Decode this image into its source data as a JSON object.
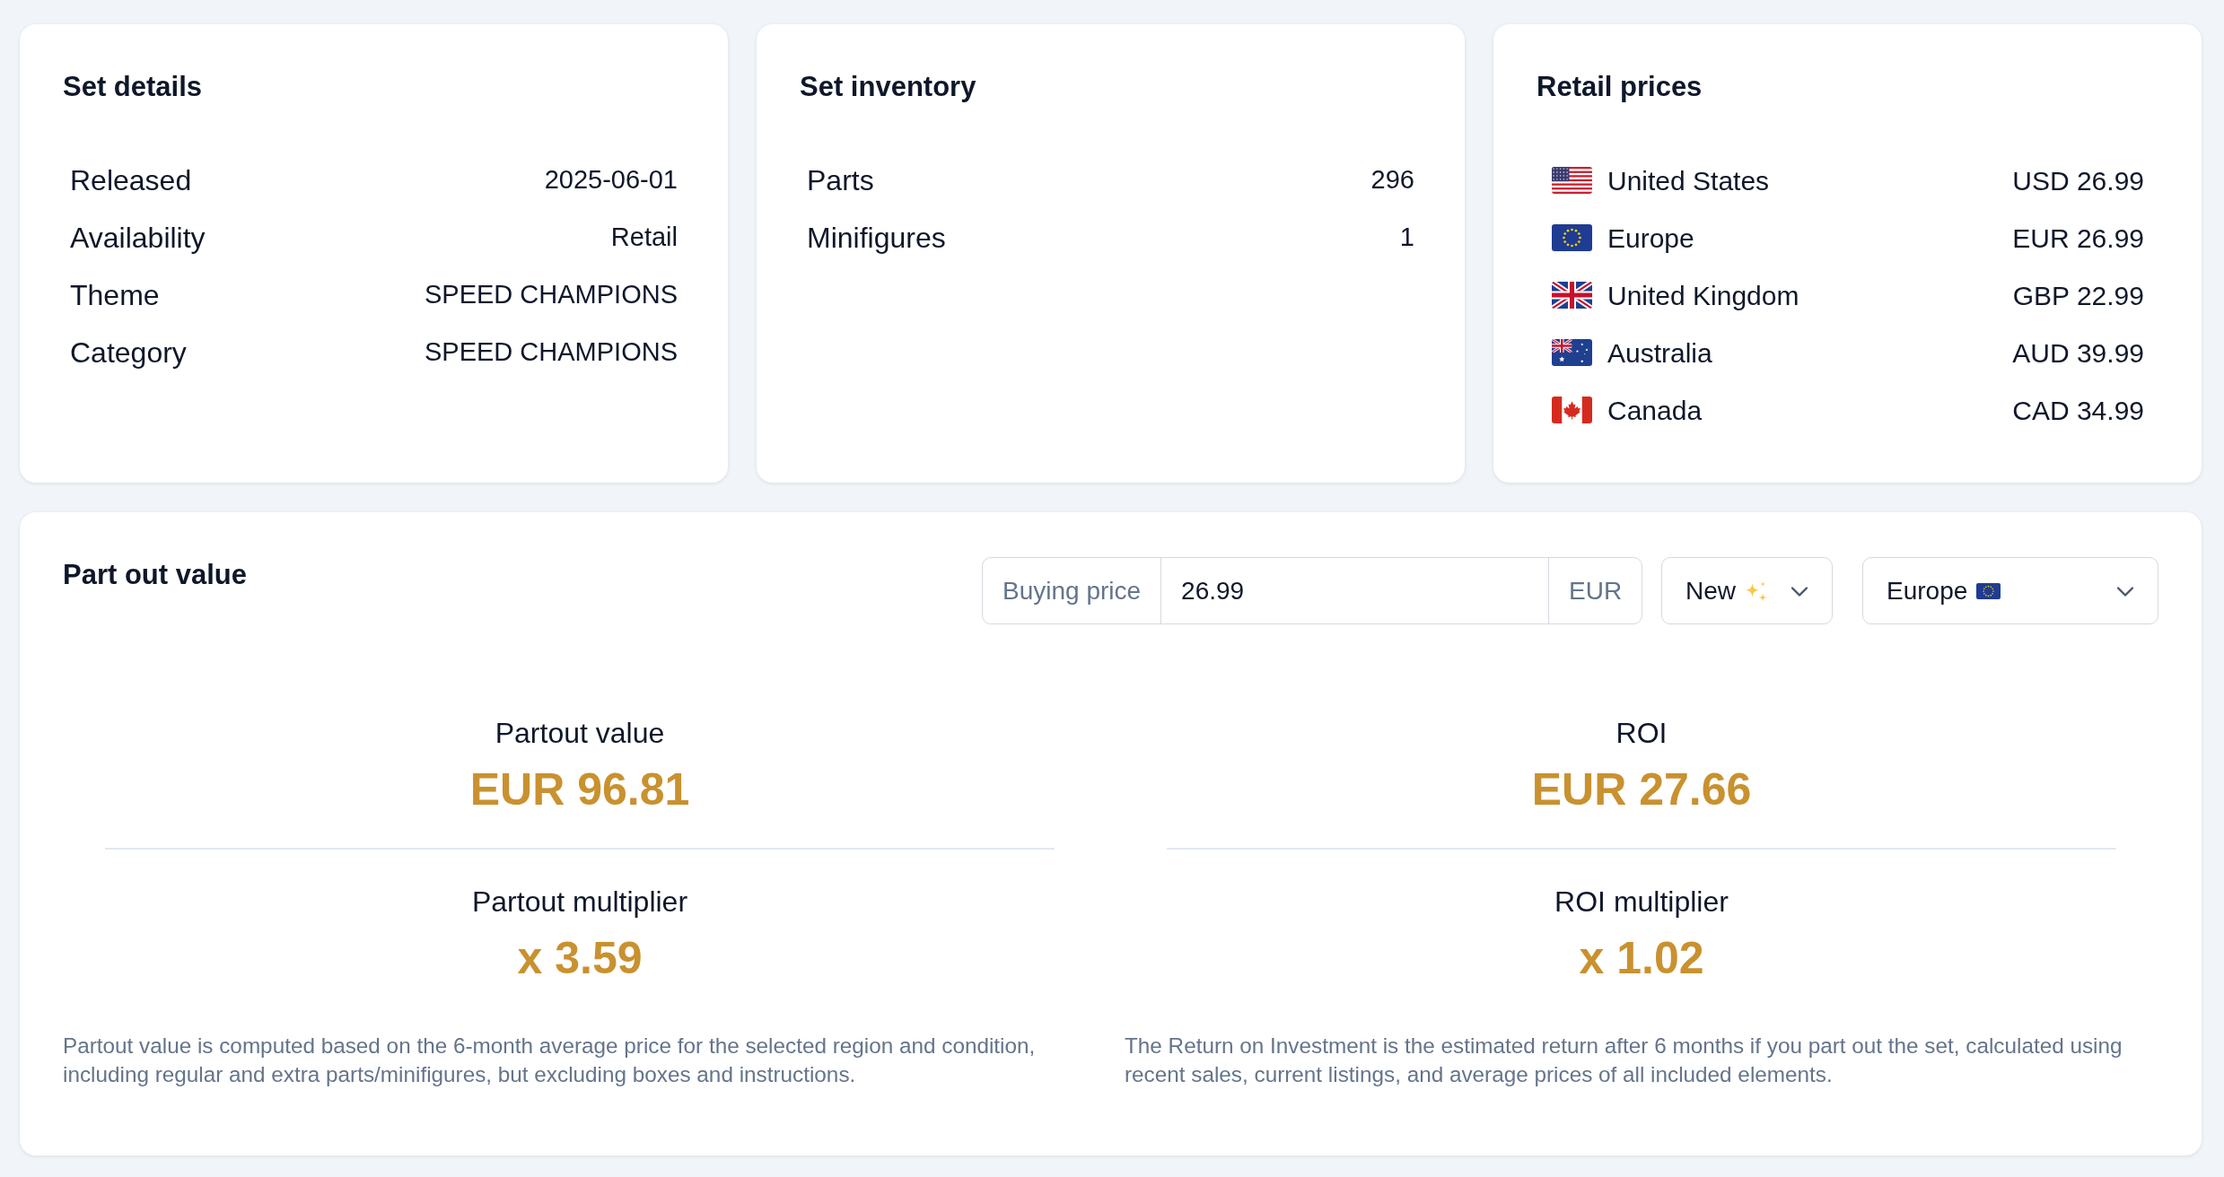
{
  "set_details": {
    "title": "Set details",
    "rows": [
      {
        "label": "Released",
        "value": "2025-06-01"
      },
      {
        "label": "Availability",
        "value": "Retail"
      },
      {
        "label": "Theme",
        "value": "SPEED CHAMPIONS"
      },
      {
        "label": "Category",
        "value": "SPEED CHAMPIONS"
      }
    ]
  },
  "set_inventory": {
    "title": "Set inventory",
    "rows": [
      {
        "label": "Parts",
        "value": "296"
      },
      {
        "label": "Minifigures",
        "value": "1"
      }
    ]
  },
  "retail_prices": {
    "title": "Retail prices",
    "rows": [
      {
        "kind": "us",
        "country": "United States",
        "price": "USD 26.99"
      },
      {
        "kind": "eu",
        "country": "Europe",
        "price": "EUR 26.99"
      },
      {
        "kind": "uk",
        "country": "United Kingdom",
        "price": "GBP 22.99"
      },
      {
        "kind": "au",
        "country": "Australia",
        "price": "AUD 39.99"
      },
      {
        "kind": "ca",
        "country": "Canada",
        "price": "CAD 34.99"
      }
    ]
  },
  "part_out_value": {
    "title": "Part out value",
    "buying_price": {
      "label": "Buying price",
      "value": "26.99",
      "currency": "EUR"
    },
    "condition_select": {
      "label": "New"
    },
    "region_select": {
      "label": "Europe",
      "kind": "eu"
    },
    "columns": [
      {
        "metrics": [
          {
            "label": "Partout value",
            "value": "EUR 96.81"
          },
          {
            "label": "Partout multiplier",
            "value": "x 3.59"
          }
        ],
        "note": "Partout value is computed based on the 6-month average price for the selected region and condition, including regular and extra parts/minifigures, but excluding boxes and instructions."
      },
      {
        "metrics": [
          {
            "label": "ROI",
            "value": "EUR 27.66"
          },
          {
            "label": "ROI multiplier",
            "value": "x 1.02"
          }
        ],
        "note": "The Return on Investment is the estimated return after 6 months if you part out the set, calculated using recent sales, current listings, and average prices of all included elements."
      }
    ]
  }
}
